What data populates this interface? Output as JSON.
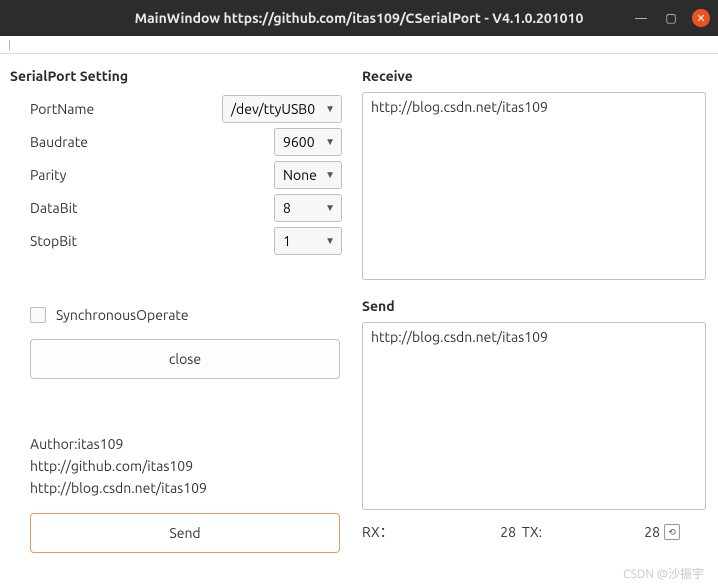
{
  "window": {
    "title": "MainWindow https://github.com/itas109/CSerialPort - V4.1.0.201010"
  },
  "settings": {
    "heading": "SerialPort Setting",
    "portname_label": "PortName",
    "portname_value": "/dev/ttyUSB0",
    "baudrate_label": "Baudrate",
    "baudrate_value": "9600",
    "parity_label": "Parity",
    "parity_value": "None",
    "databit_label": "DataBit",
    "databit_value": "8",
    "stopbit_label": "StopBit",
    "stopbit_value": "1",
    "sync_label": "SynchronousOperate",
    "close_btn": "close",
    "send_btn": "Send"
  },
  "info": {
    "author": "Author:itas109",
    "github": "http://github.com/itas109",
    "blog": "http://blog.csdn.net/itas109"
  },
  "receive": {
    "heading": "Receive",
    "content": "http://blog.csdn.net/itas109"
  },
  "send": {
    "heading": "Send",
    "content": "http://blog.csdn.net/itas109"
  },
  "status": {
    "rx_label": "RX：",
    "rx_value": "28",
    "tx_label": "TX:",
    "tx_value": "28"
  },
  "watermark": "CSDN @沙振宇"
}
